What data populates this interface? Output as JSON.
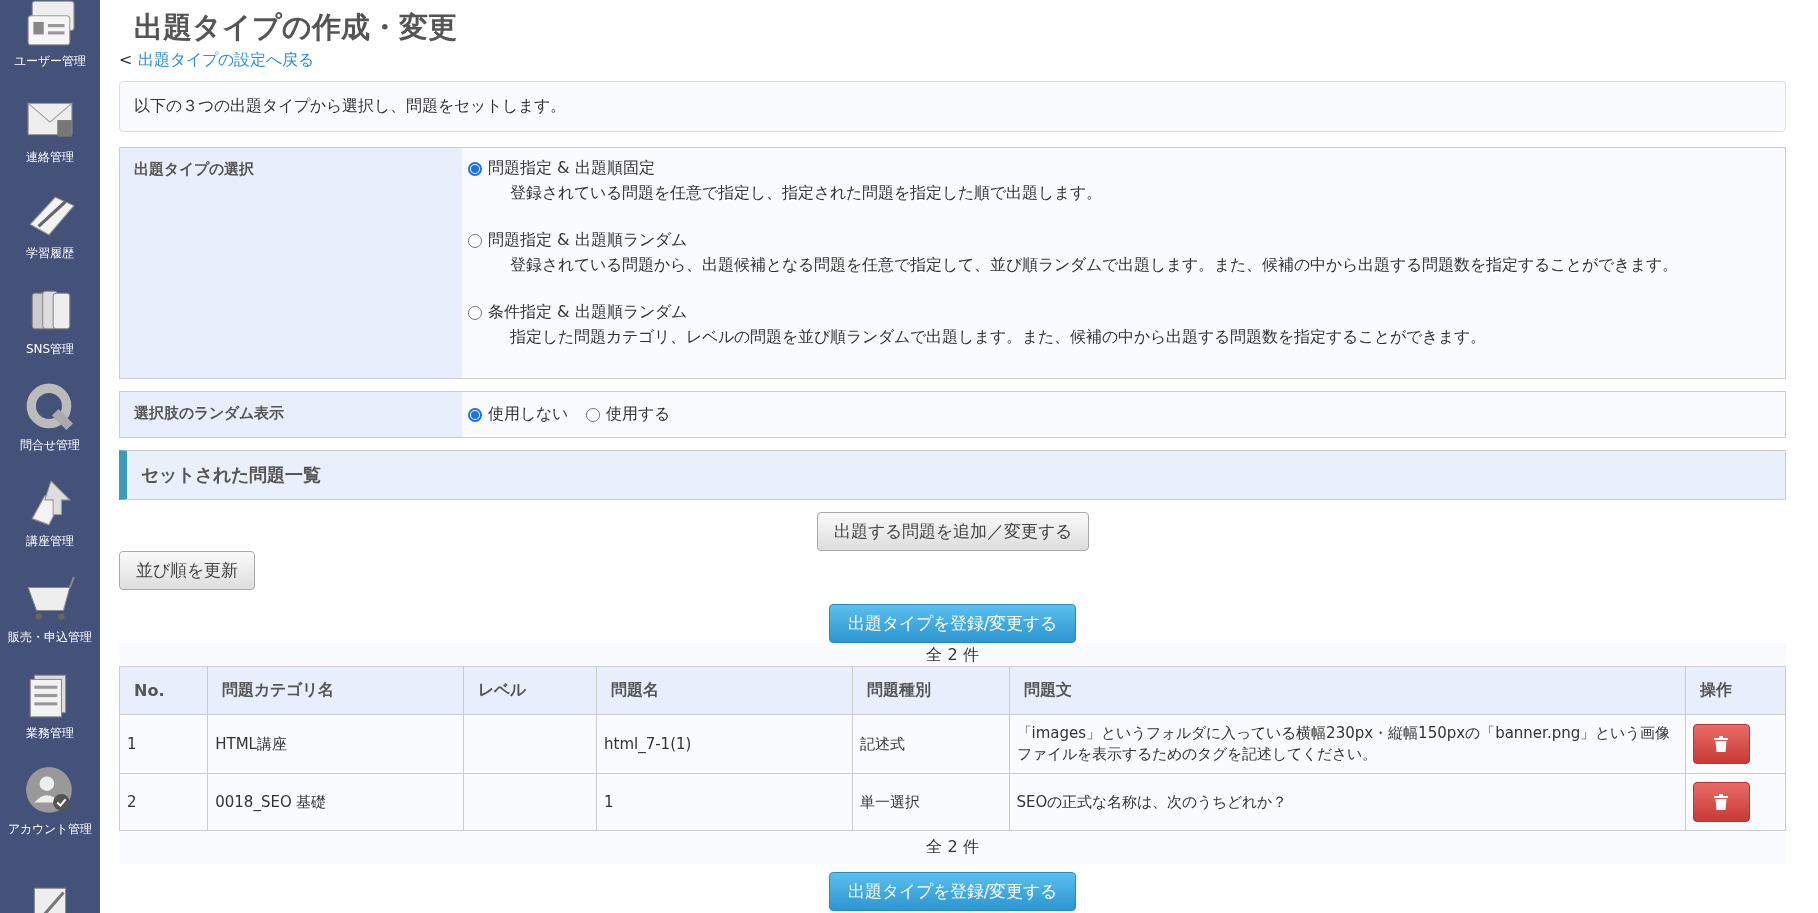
{
  "sidebar": {
    "items": [
      {
        "label": "ユーザー管理",
        "kind": "cards"
      },
      {
        "label": "連絡管理",
        "kind": "mail"
      },
      {
        "label": "学習履歴",
        "kind": "notepad"
      },
      {
        "label": "SNS管理",
        "kind": "phones"
      },
      {
        "label": "問合せ管理",
        "kind": "q"
      },
      {
        "label": "講座管理",
        "kind": "arrow"
      },
      {
        "label": "販売・申込管理",
        "kind": "cart"
      },
      {
        "label": "業務管理",
        "kind": "paper"
      },
      {
        "label": "アカウント管理",
        "kind": "person"
      },
      {
        "kind": "document"
      }
    ]
  },
  "page": {
    "title": "出題タイプの作成・変更",
    "back_arrow": "<",
    "back_link": "出題タイプの設定へ戻る",
    "intro": "以下の３つの出題タイプから選択し、問題をセットします。"
  },
  "type_section": {
    "label": "出題タイプの選択",
    "options": [
      {
        "title": "問題指定 & 出題順固定",
        "description": "登録されている問題を任意で指定し、指定された問題を指定した順で出題します。",
        "selected": true
      },
      {
        "title": "問題指定 & 出題順ランダム",
        "description": "登録されている問題から、出題候補となる問題を任意で指定して、並び順ランダムで出題します。また、候補の中から出題する問題数を指定することができます。",
        "selected": false
      },
      {
        "title": "条件指定 & 出題順ランダム",
        "description": "指定した問題カテゴリ、レベルの問題を並び順ランダムで出題します。また、候補の中から出題する問題数を指定することができます。",
        "selected": false
      }
    ]
  },
  "random_section": {
    "label": "選択肢のランダム表示",
    "options": [
      {
        "label": "使用しない",
        "selected": true
      },
      {
        "label": "使用する",
        "selected": false
      }
    ]
  },
  "list_section": {
    "heading": "セットされた問題一覧",
    "add_button": "出題する問題を追加／変更する",
    "sort_button": "並び順を更新",
    "register_button_top": "出題タイプを登録/変更する",
    "count_top": "全 2 件",
    "count_bottom": "全 2 件",
    "register_button_bottom": "出題タイプを登録/変更する"
  },
  "table": {
    "columns": [
      "No.",
      "問題カテゴリ名",
      "レベル",
      "問題名",
      "問題種別",
      "問題文",
      "操作"
    ],
    "rows": [
      {
        "no": "1",
        "category": "HTML講座",
        "name": "html_7-1(1)",
        "type": "記述式",
        "text": "「images」というフォルダに入っている横幅230px・縦幅150pxの「banner.png」という画像ファイルを表示するためのタグを記述してください。"
      },
      {
        "no": "2",
        "category": "0018_SEO 基礎",
        "name": "1",
        "type": "単一選択",
        "text": "SEOの正式な名称は、次のうちどれか？"
      }
    ]
  }
}
